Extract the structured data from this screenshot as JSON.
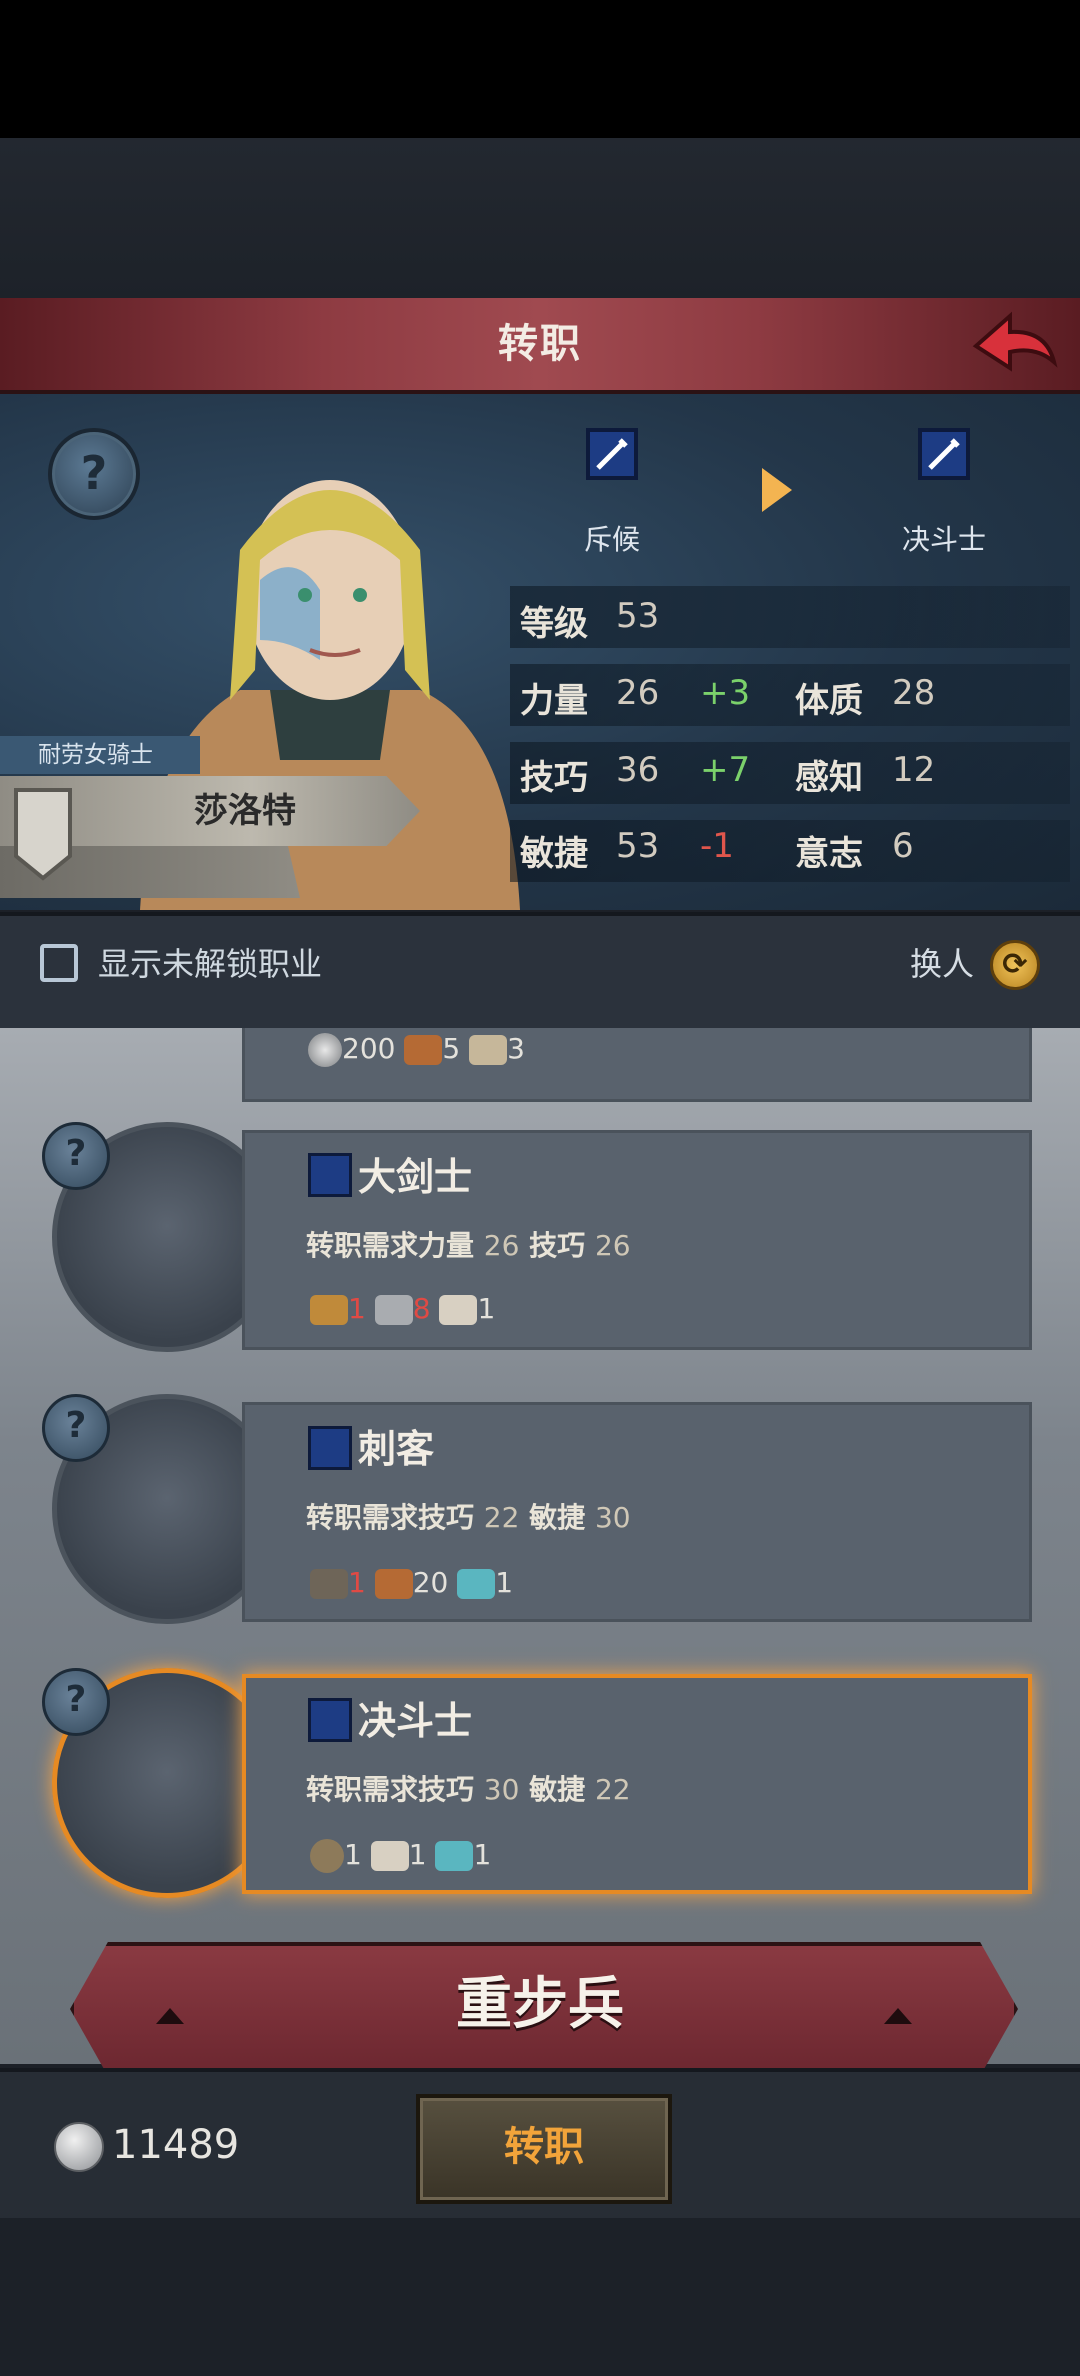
{
  "header": {
    "title": "转职"
  },
  "character": {
    "class_name": "耐劳女骑士",
    "name": "莎洛特",
    "current_job": "斥候",
    "target_job": "决斗士",
    "stats": {
      "level_label": "等级",
      "level_value": "53",
      "rows": [
        {
          "l1": "力量",
          "v1": "26",
          "d1": "+3",
          "l2": "体质",
          "v2": "28"
        },
        {
          "l1": "技巧",
          "v1": "36",
          "d1": "+7",
          "l2": "感知",
          "v2": "12"
        },
        {
          "l1": "敏捷",
          "v1": "53",
          "d1": "-1",
          "l2": "意志",
          "v2": "6"
        }
      ]
    }
  },
  "filter": {
    "show_locked_label": "显示未解锁职业",
    "swap_label": "换人"
  },
  "jobs": [
    {
      "title": "",
      "materials": [
        {
          "count": "200",
          "icon": "silver-coin-icon"
        },
        {
          "count": "5",
          "icon": "leather-icon"
        },
        {
          "count": "3",
          "icon": "wood-icon"
        }
      ]
    },
    {
      "title": "大剑士",
      "req_prefix": "转职需求",
      "req1_name": "力量",
      "req1_val": "26",
      "req2_name": "技巧",
      "req2_val": "26",
      "materials": [
        {
          "count": "1",
          "icon": "medal-icon",
          "red": true
        },
        {
          "count": "8",
          "icon": "iron-bar-icon",
          "red": true
        },
        {
          "count": "1",
          "icon": "fur-icon"
        }
      ]
    },
    {
      "title": "刺客",
      "req_prefix": "转职需求",
      "req1_name": "技巧",
      "req1_val": "22",
      "req2_name": "敏捷",
      "req2_val": "30",
      "materials": [
        {
          "count": "1",
          "icon": "dagger-icon",
          "red": true
        },
        {
          "count": "20",
          "icon": "leather-icon"
        },
        {
          "count": "1",
          "icon": "cloth-icon"
        }
      ]
    },
    {
      "title": "决斗士",
      "req_prefix": "转职需求",
      "req1_name": "技巧",
      "req1_val": "30",
      "req2_name": "敏捷",
      "req2_val": "22",
      "materials": [
        {
          "count": "1",
          "icon": "ring-icon"
        },
        {
          "count": "1",
          "icon": "fur-icon"
        },
        {
          "count": "1",
          "icon": "cloth-icon"
        }
      ]
    }
  ],
  "bottom": {
    "class_banner": "重步兵",
    "silver": "11489",
    "confirm_label": "转职"
  },
  "colors": {
    "accent_orange": "#e68a23",
    "stat_up": "#7bd16b",
    "stat_down": "#e0564c",
    "title_bar": "#8e3b42"
  }
}
